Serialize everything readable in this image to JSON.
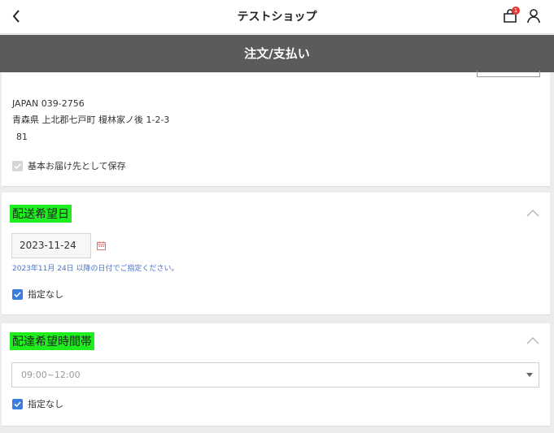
{
  "header": {
    "title": "テストショップ",
    "cart_badge": "1"
  },
  "subheader": {
    "title": "注文/支払い"
  },
  "address": {
    "line1": "JAPAN 039-2756",
    "line2": "青森県 上北郡七戸町 榎林家ノ後 1-2-3",
    "line3": "81",
    "save_default_label": "基本お届け先として保存"
  },
  "delivery_date": {
    "title": "配送希望日",
    "date_value": "2023-11-24",
    "note": "2023年11月 24日 以降の日付でご指定ください。",
    "none_label": "指定なし"
  },
  "delivery_time": {
    "title": "配達希望時間帯",
    "selected": "09:00~12:00",
    "none_label": "指定なし"
  },
  "colors": {
    "highlight": "#1eee1e",
    "accent": "#3b7de0",
    "header_bar": "#5b5b5b",
    "badge": "#e53935"
  }
}
